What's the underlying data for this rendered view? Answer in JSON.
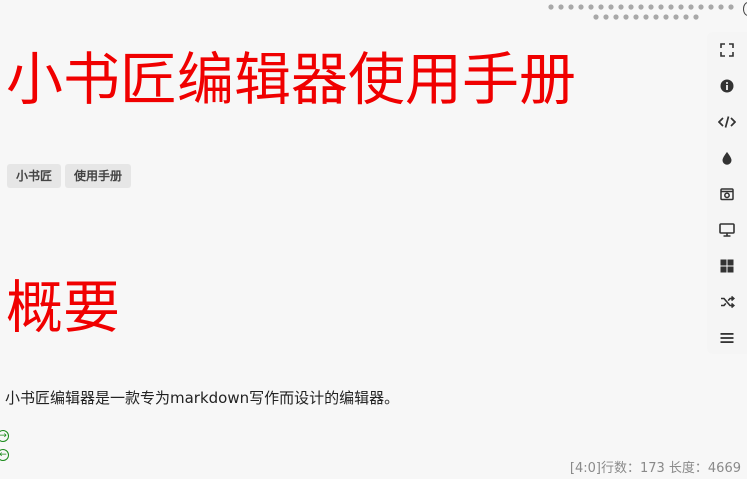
{
  "document": {
    "title": "小书匠编辑器使用手册",
    "tags": [
      "小书匠",
      "使用手册"
    ],
    "section_heading": "概要",
    "paragraph": "小书匠编辑器是一款专为markdown写作而设计的编辑器。",
    "next_symbol": "→",
    "prev_symbol": "←"
  },
  "status_bar": {
    "text": "[4:0]行数：173 长度：4669"
  },
  "toolbar": {
    "buttons": [
      {
        "name": "fullscreen",
        "icon": "fullscreen-icon"
      },
      {
        "name": "info",
        "icon": "info-icon"
      },
      {
        "name": "code",
        "icon": "code-icon"
      },
      {
        "name": "theme",
        "icon": "droplet-icon"
      },
      {
        "name": "screenshot",
        "icon": "camera-icon"
      },
      {
        "name": "presentation",
        "icon": "monitor-icon"
      },
      {
        "name": "layout",
        "icon": "grid-icon"
      },
      {
        "name": "shuffle",
        "icon": "shuffle-icon"
      },
      {
        "name": "menu",
        "icon": "menu-icon"
      }
    ]
  },
  "colors": {
    "heading": "#f00000",
    "tag_bg": "#e6e6e6",
    "status_text": "#8a8a8a",
    "nav_circle": "#1a8a1a",
    "icon": "#333333"
  }
}
